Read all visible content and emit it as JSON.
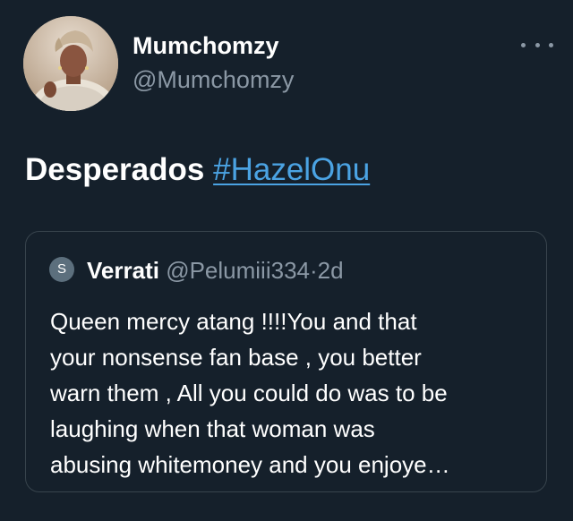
{
  "author": {
    "name": "Mumchomzy",
    "handle": "@Mumchomzy",
    "avatar_icon": "profile-photo"
  },
  "more_icon": "more-options-icon",
  "tweet": {
    "text": "Desperados",
    "hashtag": "#HazelOnu"
  },
  "quoted": {
    "avatar_letter": "S",
    "name": "Verrati",
    "handle": "@Pelumiii334",
    "separator": "·",
    "time": "2d",
    "lines": [
      "Queen mercy atang !!!!You and that",
      "your nonsense fan base , you better",
      "warn them , All you could do was to be",
      "laughing when that woman was",
      "abusing whitemoney and you enjoye…"
    ]
  },
  "colors": {
    "background": "#15202b",
    "text_primary": "#ffffff",
    "text_secondary": "#8b98a5",
    "link": "#4ba3e3",
    "border": "#38444d"
  }
}
